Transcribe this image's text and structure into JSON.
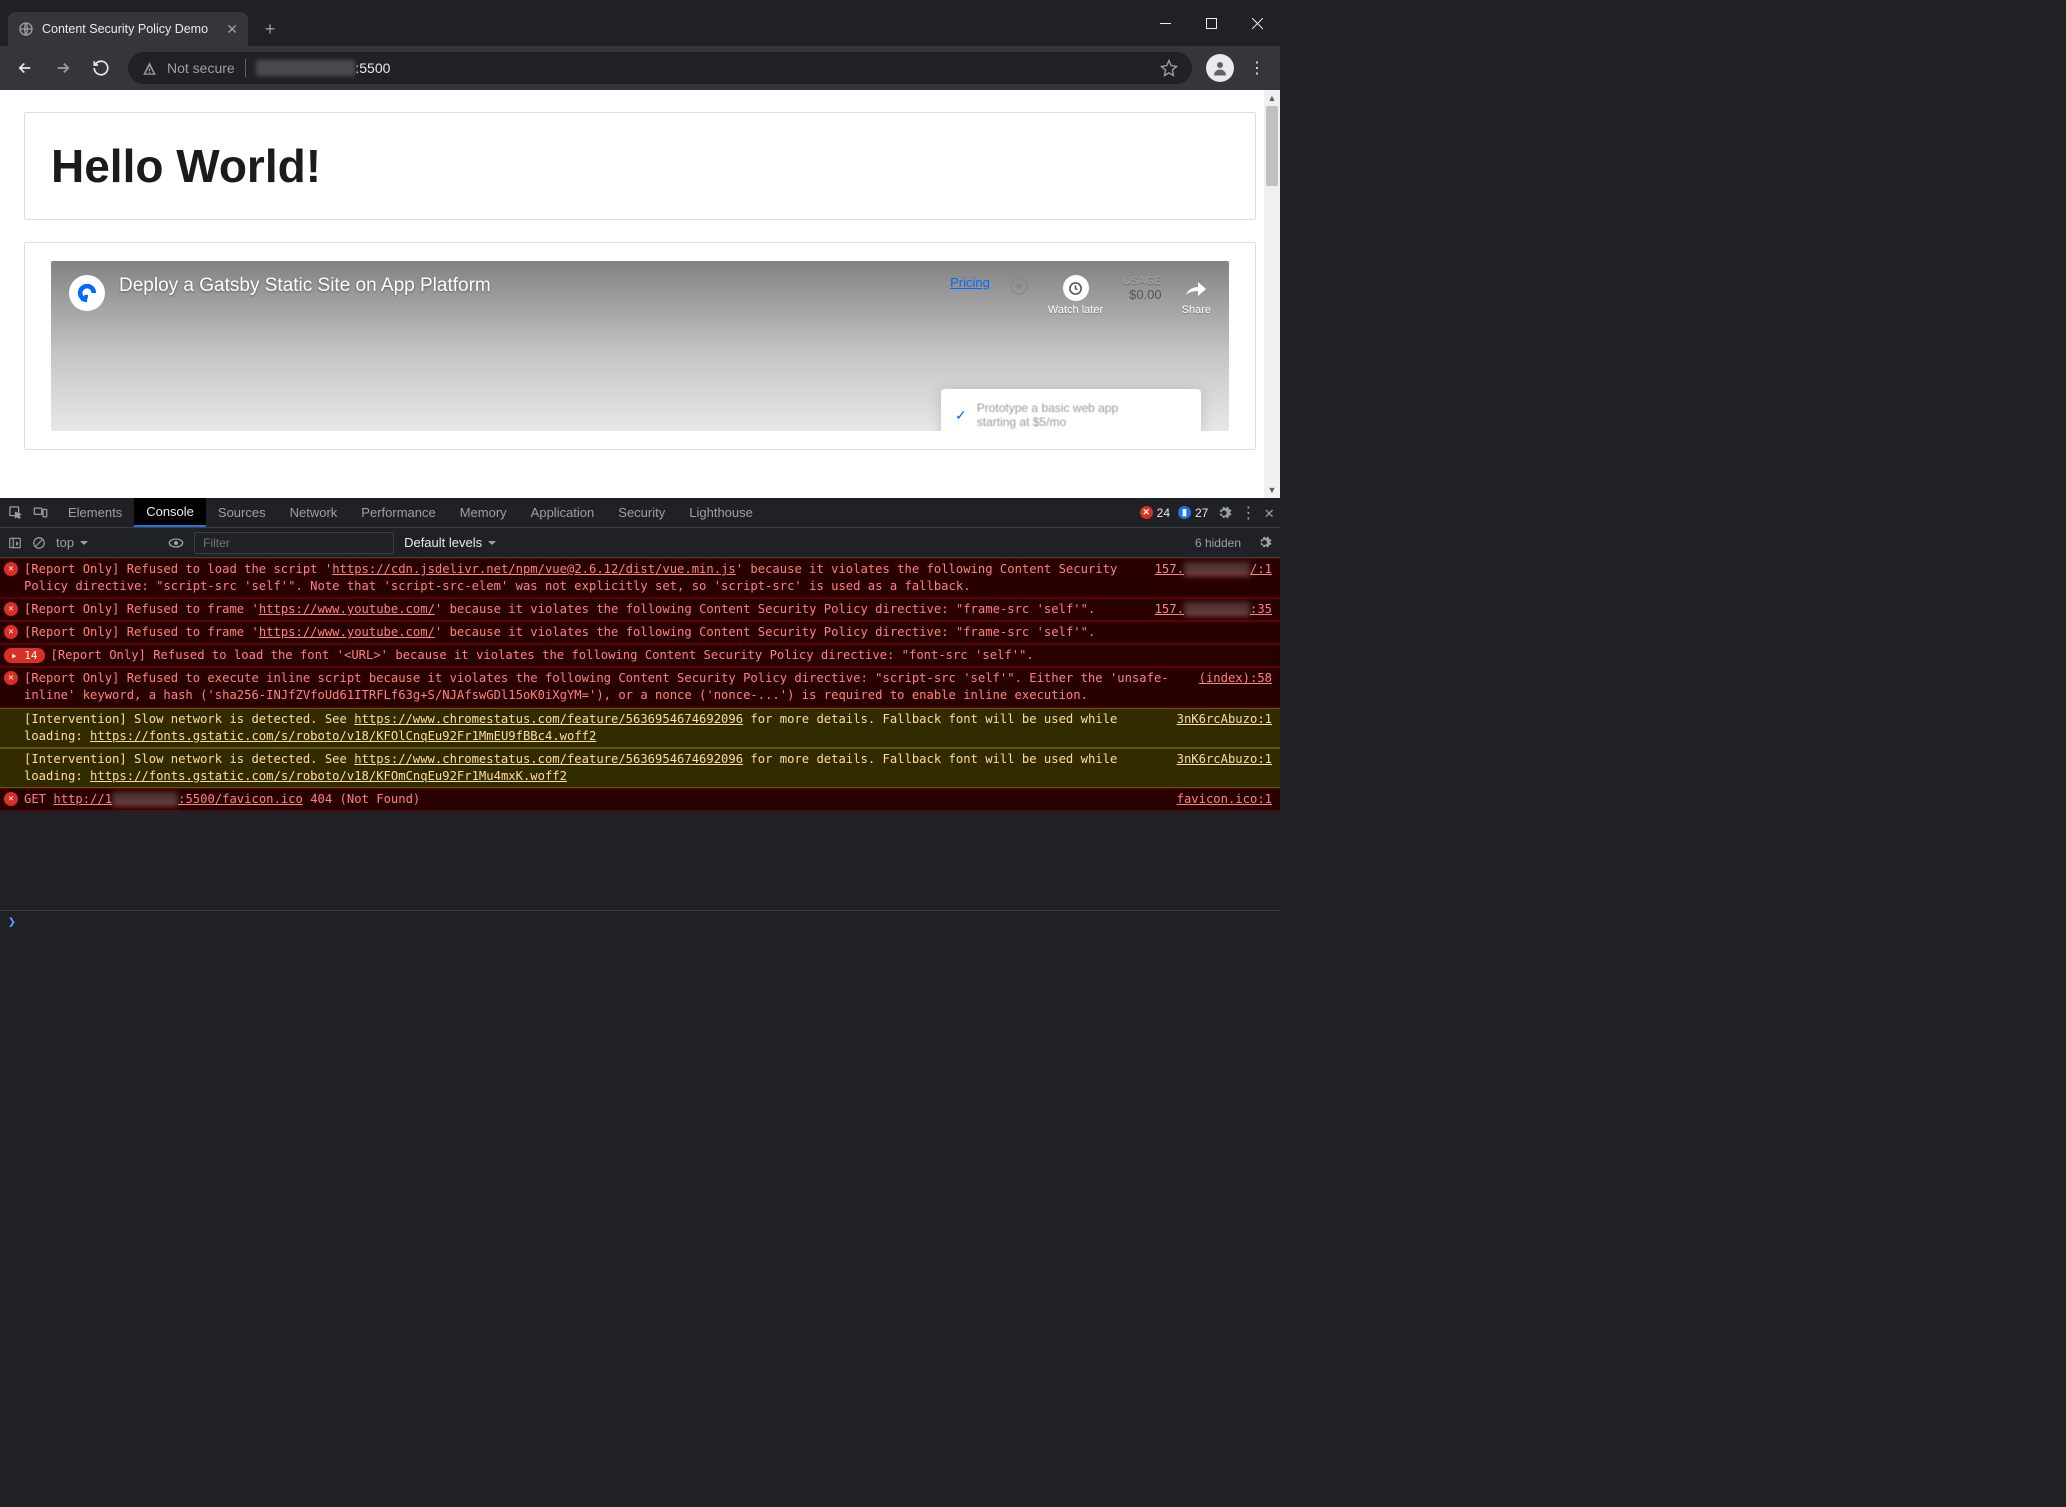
{
  "window": {
    "tab_title": "Content Security Policy Demo"
  },
  "toolbar": {
    "security_label": "Not secure",
    "url_suffix": ":5500"
  },
  "page": {
    "heading": "Hello World!",
    "video": {
      "title": "Deploy a Gatsby Static Site on App Platform",
      "pricing_label": "Pricing",
      "watch_later": "Watch later",
      "share": "Share",
      "usage_label": "USAGE",
      "usage_amount": "$0.00",
      "popup_line1": "Prototype a basic web app",
      "popup_line2": "starting at $5/mo"
    }
  },
  "devtools": {
    "tabs": [
      "Elements",
      "Console",
      "Sources",
      "Network",
      "Performance",
      "Memory",
      "Application",
      "Security",
      "Lighthouse"
    ],
    "active_tab": "Console",
    "error_count": "24",
    "info_count": "27",
    "context": "top",
    "filter_placeholder": "Filter",
    "levels": "Default levels",
    "hidden": "6 hidden",
    "logs": [
      {
        "type": "error",
        "pre": "[Report Only] Refused to load the script '",
        "link": "https://cdn.jsdelivr.net/npm/vue@2.6.12/dist/vue.min.js",
        "post": "' because it violates the following Content Security Policy directive: \"script-src 'self'\". Note that 'script-src-elem' was not explicitly set, so 'script-src' is used as a fallback.",
        "src_prefix": "157.",
        "src_suffix": "/:1"
      },
      {
        "type": "error",
        "pre": "[Report Only] Refused to frame '",
        "link": "https://www.youtube.com/",
        "post": "' because it violates the following Content Security Policy directive: \"frame-src 'self'\".",
        "src_prefix": "157.",
        "src_suffix": ":35"
      },
      {
        "type": "error",
        "pre": "[Report Only] Refused to frame '",
        "link": "https://www.youtube.com/",
        "post": "' because it violates the following Content Security Policy directive: \"frame-src 'self'\".",
        "src": ""
      },
      {
        "type": "error-count",
        "count": "14",
        "msg": "[Report Only] Refused to load the font '<URL>' because it violates the following Content Security Policy directive: \"font-src 'self'\"."
      },
      {
        "type": "error",
        "pre": "[Report Only] Refused to execute inline script because it violates the following Content Security Policy directive: \"script-src 'self'\". Either the 'unsafe-inline' keyword, a hash ('sha256-INJfZVfoUd61ITRFLf63g+S/NJAfswGDl15oK0iXgYM='), or a nonce ('nonce-...') is required to enable inline execution.",
        "link": "",
        "post": "",
        "src": "(index):58"
      },
      {
        "type": "warn",
        "pre": "[Intervention] Slow network is detected. See ",
        "link1": "https://www.chromestatus.com/feature/5636954674692096",
        "mid": " for more details. Fallback font will be used while loading: ",
        "link2": "https://fonts.gstatic.com/s/roboto/v18/KFOlCnqEu92Fr1MmEU9fBBc4.woff2",
        "src": "3nK6rcAbuzo:1"
      },
      {
        "type": "warn",
        "pre": "[Intervention] Slow network is detected. See ",
        "link1": "https://www.chromestatus.com/feature/5636954674692096",
        "mid": " for more details. Fallback font will be used while loading: ",
        "link2": "https://fonts.gstatic.com/s/roboto/v18/KFOmCnqEu92Fr1Mu4mxK.woff2",
        "src": "3nK6rcAbuzo:1"
      },
      {
        "type": "error",
        "pre": "GET ",
        "link": "http://1",
        "blur_mid": "xx.xxx.xx",
        "post_link": ":5500/favicon.ico",
        "post": " 404 (Not Found)",
        "src": "favicon.ico:1"
      }
    ]
  }
}
